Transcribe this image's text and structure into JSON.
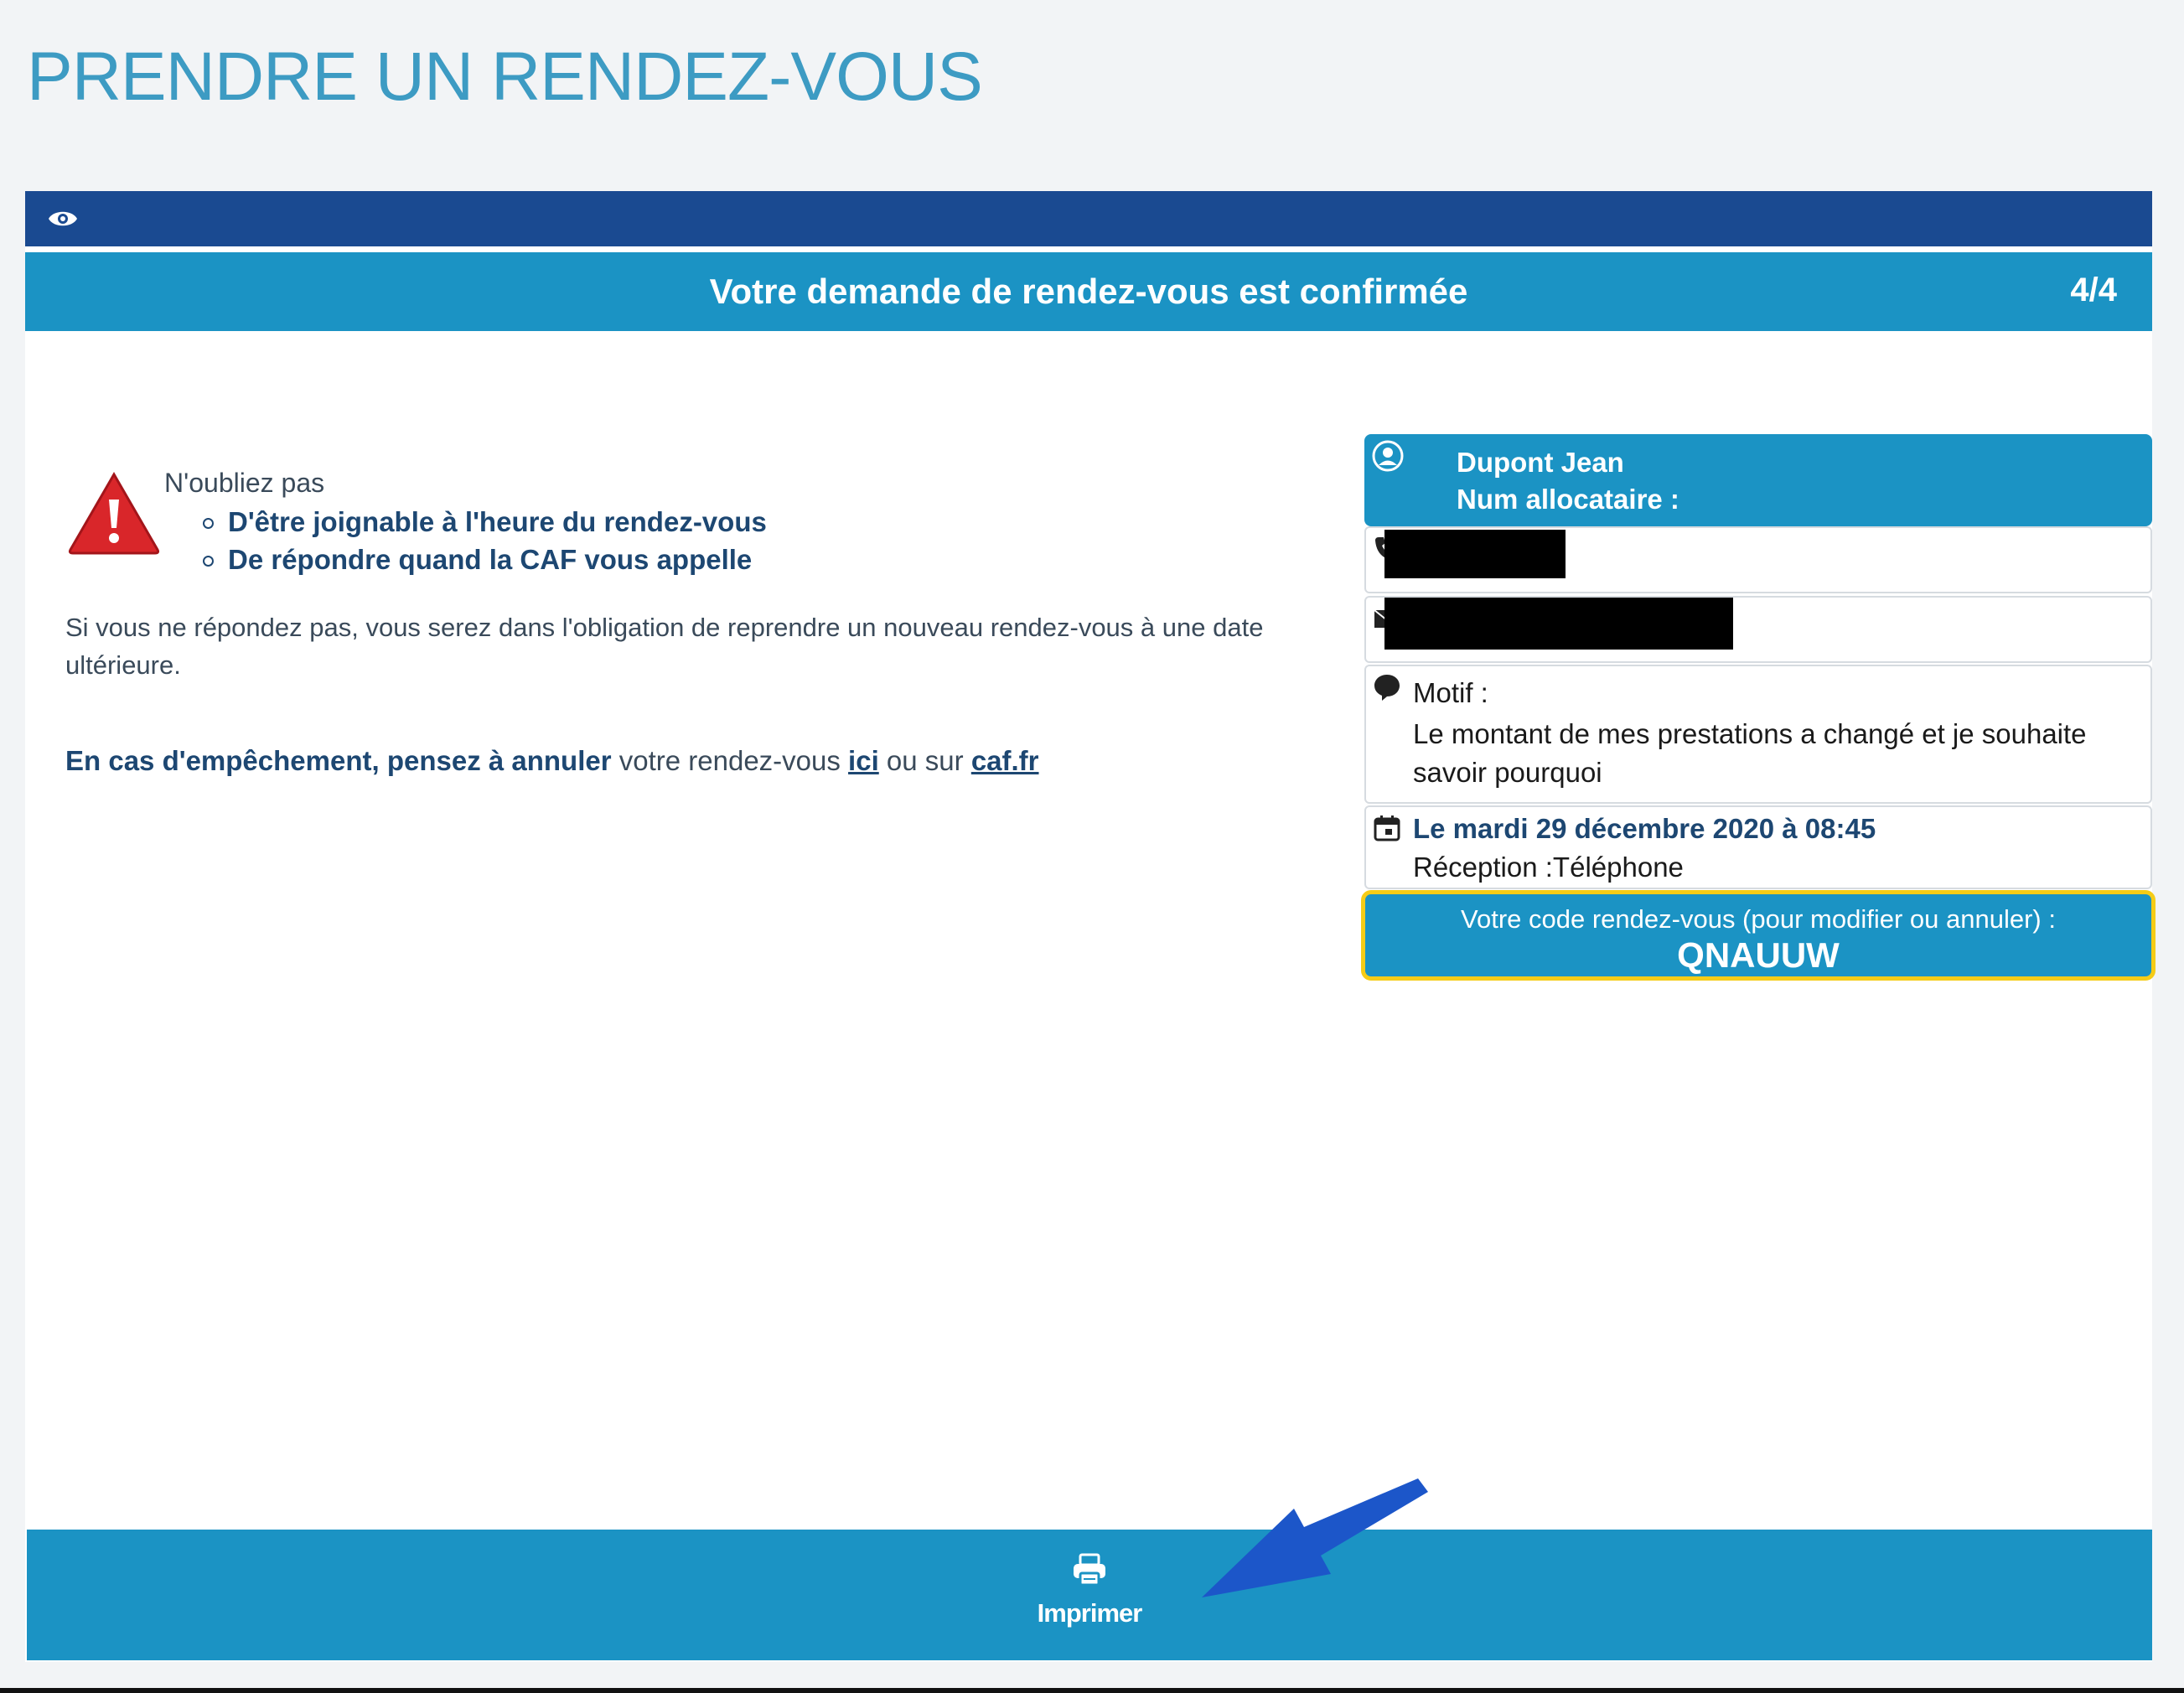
{
  "page_title": "PRENDRE UN RENDEZ-VOUS",
  "header": {
    "title": "Votre demande de rendez-vous est confirmée",
    "step": "4/4"
  },
  "reminder": {
    "intro": "N'oubliez pas",
    "items": [
      "D'être joignable à l'heure du rendez-vous",
      "De répondre quand la CAF vous appelle"
    ]
  },
  "notice": "Si vous ne répondez pas, vous serez dans l'obligation de reprendre un nouveau rendez-vous à une date ultérieure.",
  "cancel": {
    "bold_text": "En cas d'empêchement, pensez à annuler",
    "mid_text": " votre rendez-vous ",
    "link_here": "ici",
    "or_text": " ou sur ",
    "link_site": "caf.fr"
  },
  "summary": {
    "name": "Dupont Jean",
    "num_label": "Num allocataire :",
    "motif_label": "Motif :",
    "motif_text": "Le montant de mes prestations a changé et je souhaite savoir pourquoi",
    "date": "Le mardi 29 décembre 2020 à 08:45",
    "reception": "Réception :Téléphone",
    "code_label": "Votre code rendez-vous (pour modifier ou annuler) :",
    "code_value": "QNAUUW"
  },
  "footer": {
    "print_label": "Imprimer"
  },
  "colors": {
    "title_blue": "#3d9bc3",
    "dark_bar": "#1a4a91",
    "primary": "#1b93c4",
    "highlight_border": "#f5cc17",
    "arrow": "#1c56c9",
    "warning_red": "#d9262a"
  },
  "icons": {
    "header": "eye-icon",
    "warning": "warning-triangle-icon",
    "user": "user-circle-icon",
    "phone": "phone-icon",
    "mail": "mail-icon",
    "motif": "speech-bubble-icon",
    "date": "calendar-icon",
    "print": "printer-icon",
    "annotation": "arrow-icon"
  }
}
